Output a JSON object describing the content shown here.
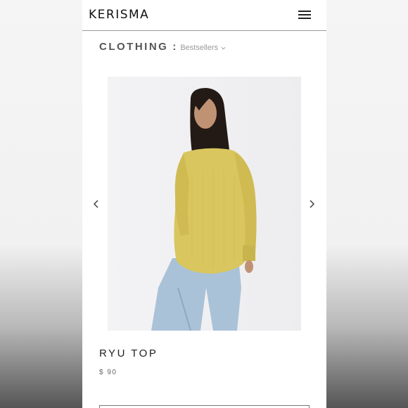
{
  "header": {
    "logo": "KERISMA",
    "menu_icon": "hamburger-menu-icon"
  },
  "breadcrumb": {
    "category": "CLOTHING",
    "separator": ":",
    "filter": "Bestsellers",
    "filter_icon": "chevron-down-icon"
  },
  "carousel": {
    "prev_icon": "chevron-left-icon",
    "next_icon": "chevron-right-icon"
  },
  "product": {
    "name": "RYU TOP",
    "price": "$ 90",
    "color": "#d8c55a"
  },
  "colors": {
    "sweater": "#d9c65e",
    "jeans": "#a9c2d8",
    "background": "#f1f1f1"
  }
}
